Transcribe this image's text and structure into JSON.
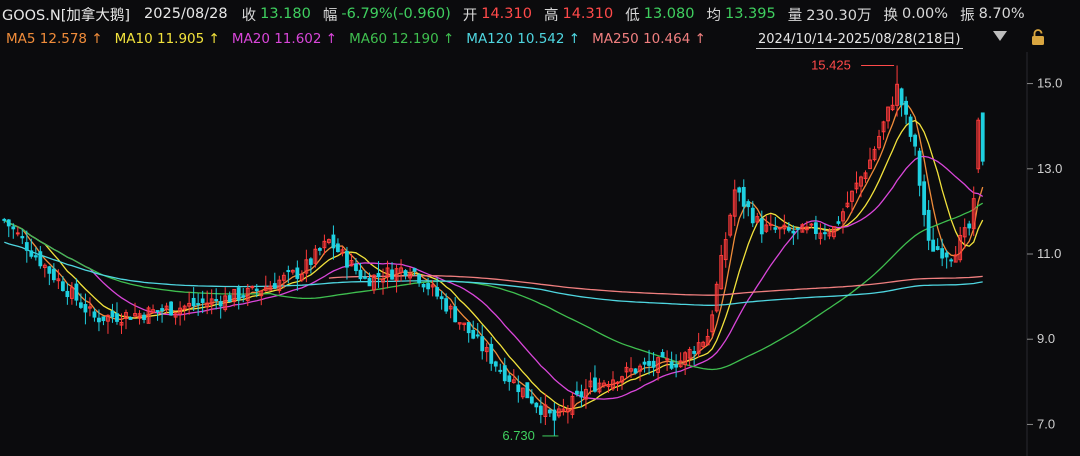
{
  "header": {
    "ticker": "GOOS.N[加拿大鹅]",
    "date": "2025/08/28",
    "close_label": "收",
    "close_value": "13.180",
    "change_label": "幅",
    "change_value": "-6.79%(-0.960)",
    "open_label": "开",
    "open_value": "14.310",
    "high_label": "高",
    "high_value": "14.310",
    "low_label": "低",
    "low_value": "13.080",
    "avg_label": "均",
    "avg_value": "13.395",
    "volume_label": "量",
    "volume_value": "230.30万",
    "turnover_label": "换",
    "turnover_value": "0.00%",
    "amplitude_label": "振",
    "amplitude_value": "8.70%"
  },
  "ma_legend": [
    {
      "label": "MA5",
      "value": "12.578",
      "arrow": "↑",
      "color": "#f08c3a"
    },
    {
      "label": "MA10",
      "value": "11.905",
      "arrow": "↑",
      "color": "#f2e23c"
    },
    {
      "label": "MA20",
      "value": "11.602",
      "arrow": "↑",
      "color": "#d946d9"
    },
    {
      "label": "MA60",
      "value": "12.190",
      "arrow": "↑",
      "color": "#3fbf4f"
    },
    {
      "label": "MA120",
      "value": "10.542",
      "arrow": "↑",
      "color": "#4fd6e0"
    },
    {
      "label": "MA250",
      "value": "10.464",
      "arrow": "↑",
      "color": "#f07f7f"
    }
  ],
  "range": {
    "text": "2024/10/14-2025/08/28(218日)"
  },
  "colors": {
    "up": "#ff3b3b",
    "down": "#1fd0e0",
    "background": "#0b0b0d"
  },
  "chart_data": {
    "type": "candlestick",
    "period": "2024/10/14-2025/08/28",
    "bars": 218,
    "ylim": [
      6.4,
      15.6
    ],
    "yticks": [
      7.0,
      9.0,
      11.0,
      13.0,
      15.0
    ],
    "annotations": [
      {
        "text": "15.425",
        "type": "period-high",
        "value": 15.425
      },
      {
        "text": "6.730",
        "type": "period-low",
        "value": 6.73
      }
    ],
    "ohlc_anchor_points": [
      {
        "bar": 0,
        "close": 11.8
      },
      {
        "bar": 10,
        "close": 10.6
      },
      {
        "bar": 20,
        "close": 9.5
      },
      {
        "bar": 30,
        "close": 9.6
      },
      {
        "bar": 42,
        "close": 9.8
      },
      {
        "bar": 55,
        "close": 10.1
      },
      {
        "bar": 66,
        "close": 10.6
      },
      {
        "bar": 72,
        "close": 11.3
      },
      {
        "bar": 80,
        "close": 10.4
      },
      {
        "bar": 90,
        "close": 10.7
      },
      {
        "bar": 98,
        "close": 9.8
      },
      {
        "bar": 110,
        "close": 8.3
      },
      {
        "bar": 122,
        "close": 7.1
      },
      {
        "bar": 130,
        "close": 7.9
      },
      {
        "bar": 140,
        "close": 8.3
      },
      {
        "bar": 150,
        "close": 8.5
      },
      {
        "bar": 156,
        "close": 9.1
      },
      {
        "bar": 162,
        "close": 12.5
      },
      {
        "bar": 168,
        "close": 11.6
      },
      {
        "bar": 175,
        "close": 11.5
      },
      {
        "bar": 184,
        "close": 11.6
      },
      {
        "bar": 192,
        "close": 13.2
      },
      {
        "bar": 198,
        "close": 14.9
      },
      {
        "bar": 202,
        "close": 13.4
      },
      {
        "bar": 205,
        "close": 11.2
      },
      {
        "bar": 210,
        "close": 11.0
      },
      {
        "bar": 214,
        "close": 11.6
      },
      {
        "bar": 217,
        "close": 13.18
      }
    ],
    "last_bar": {
      "open": 14.31,
      "high": 14.31,
      "low": 13.08,
      "close": 13.18
    },
    "moving_averages": [
      {
        "name": "MA5",
        "last": 12.578
      },
      {
        "name": "MA10",
        "last": 11.905
      },
      {
        "name": "MA20",
        "last": 11.602
      },
      {
        "name": "MA60",
        "last": 12.19
      },
      {
        "name": "MA120",
        "last": 10.542
      },
      {
        "name": "MA250",
        "last": 10.464
      }
    ]
  }
}
